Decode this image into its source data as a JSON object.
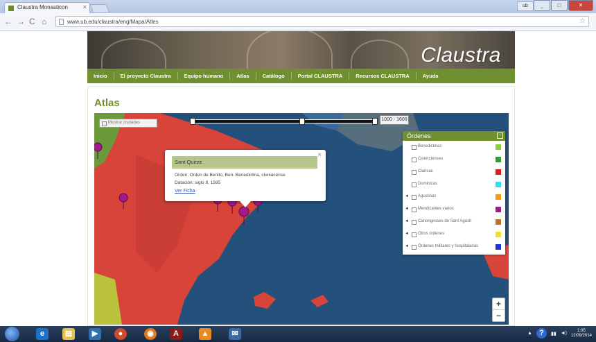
{
  "browser": {
    "tab_title": "Claustra Monasticon",
    "tab_close": "×",
    "url": "www.ub.edu/claustra/eng/Mapa/Atles",
    "star_icon": "star-icon",
    "user_label": "ub"
  },
  "site": {
    "brand": "Claustra",
    "nav": [
      "Inicio",
      "El proyecto Claustra",
      "Equipo humano",
      "Atlas",
      "Catálogo",
      "Portal CLAUSTRA",
      "Recursos CLAUSTRA",
      "Ayuda"
    ],
    "page_title": "Atlas"
  },
  "map": {
    "layer_toggle": "Mostrar ciudades",
    "year_range": "1000 - 1600",
    "zoom_in": "+",
    "zoom_out": "−",
    "popup": {
      "title": "Sant Quirze",
      "line1": "Orden: Orden de Benito, Ben. Benedictina, cluniacense",
      "line2": "Datación: siglo 8, 1585",
      "link": "Ver Ficha",
      "close": "×"
    },
    "legend": {
      "title": "Órdenes",
      "collapse": "–",
      "items": [
        {
          "label": "Benedictinas",
          "color": "#8fcf3c",
          "arrow": ""
        },
        {
          "label": "Cistercienses",
          "color": "#2e9e3a",
          "arrow": ""
        },
        {
          "label": "Clarisas",
          "color": "#e11b1b",
          "arrow": ""
        },
        {
          "label": "Dominicas",
          "color": "#2fe0f0",
          "arrow": ""
        },
        {
          "label": "Agustinas",
          "color": "#f59c10",
          "arrow": "◄"
        },
        {
          "label": "Mendicantes varios",
          "color": "#a01a8a",
          "arrow": "◄"
        },
        {
          "label": "Canongesses de Sant Agustí",
          "color": "#b8742a",
          "arrow": "◄"
        },
        {
          "label": "Otros órdenes",
          "color": "#f0e020",
          "arrow": "◄"
        },
        {
          "label": "Órdenes militares y hospitalarias",
          "color": "#2233dd",
          "arrow": "◄"
        }
      ]
    }
  },
  "taskbar": {
    "clock_time": "1:05",
    "clock_date": "12/09/2014"
  }
}
